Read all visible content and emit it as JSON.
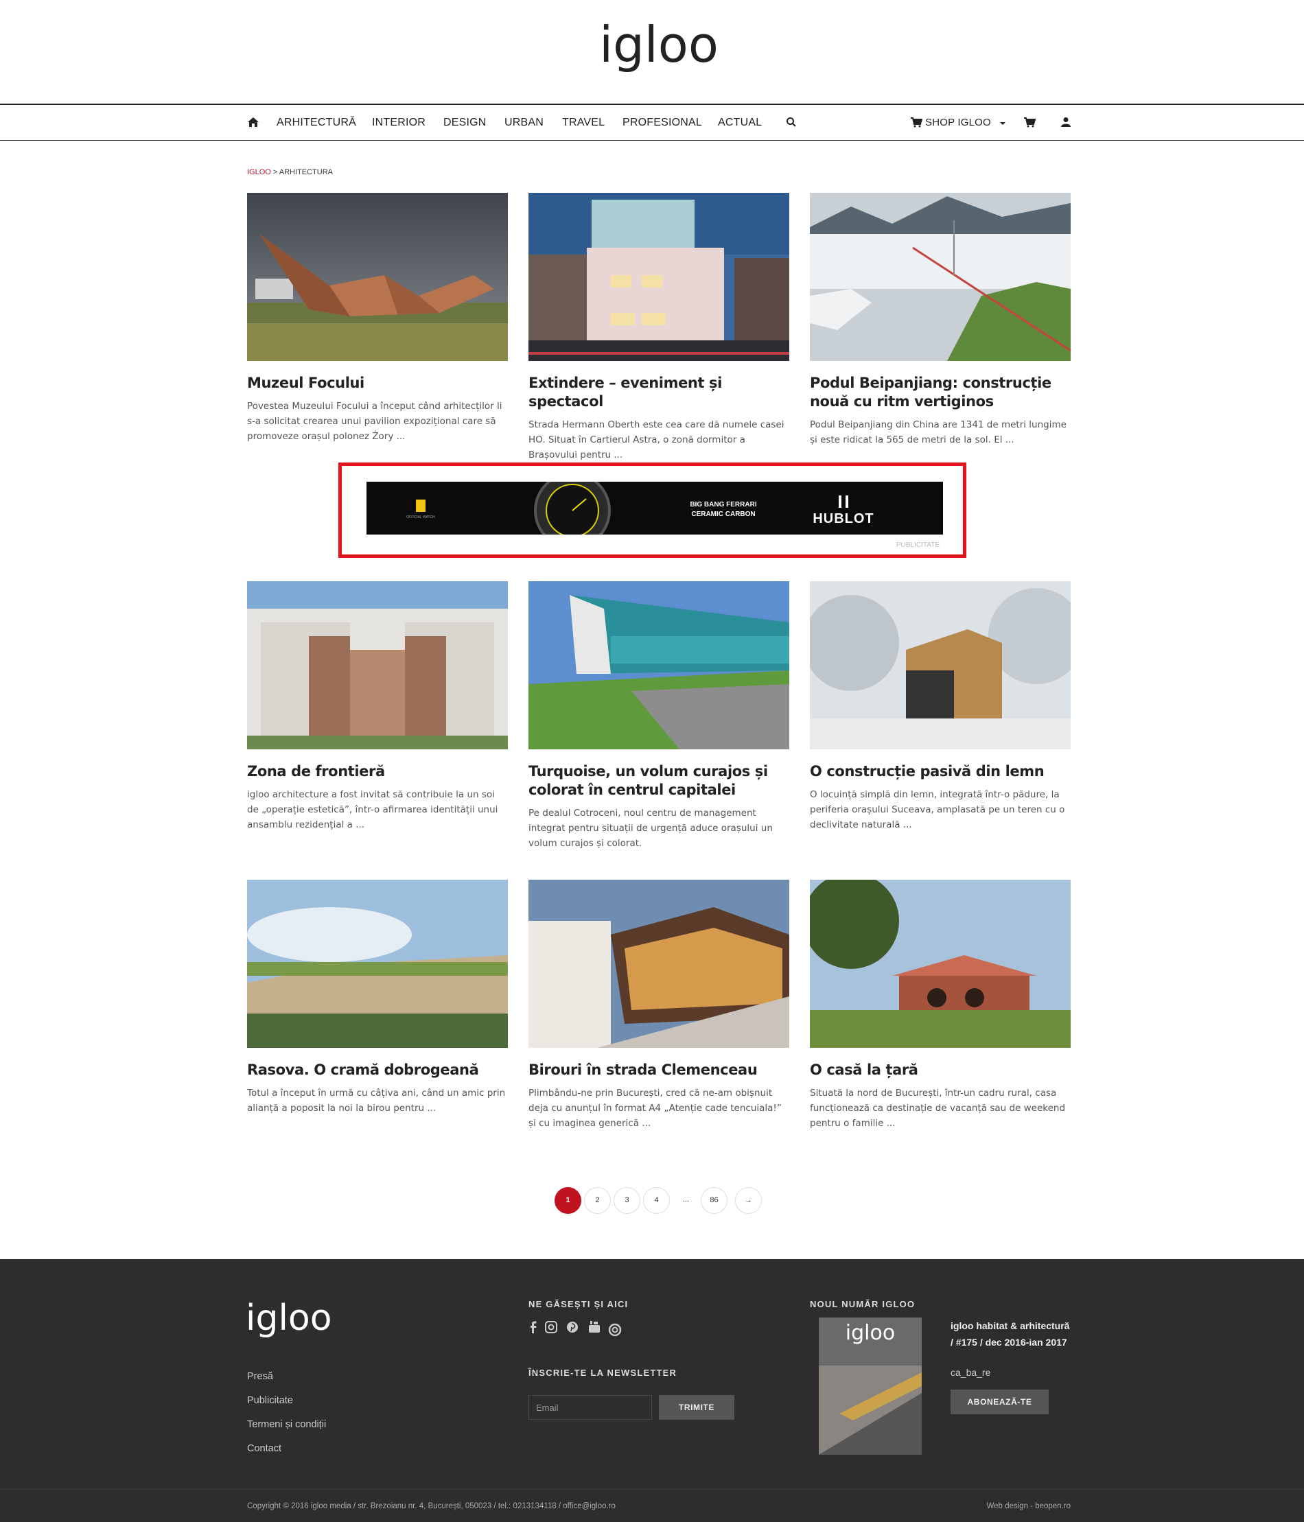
{
  "header": {
    "logo_text": "igloo"
  },
  "nav": {
    "items": [
      {
        "label": "ARHITECTURĂ"
      },
      {
        "label": "INTERIOR"
      },
      {
        "label": "DESIGN"
      },
      {
        "label": "URBAN"
      },
      {
        "label": "TRAVEL"
      },
      {
        "label": "PROFESIONAL"
      },
      {
        "label": "ACTUAL"
      }
    ],
    "shop_label": "SHOP IGLOO",
    "icons": [
      "home-icon",
      "search-icon",
      "cart-icon",
      "user-icon",
      "chevron-down-icon"
    ]
  },
  "breadcrumb": {
    "home": "IGLOO",
    "separator": " > ",
    "current": "ARHITECTURA"
  },
  "articles": [
    {
      "title": "Muzeul Focului",
      "excerpt": "Povestea Muzeului Focului a început când arhitecților li s-a solicitat crearea unui pavilion expozițional care să promoveze orașul polonez Żory ..."
    },
    {
      "title": "Extindere – eveniment și spectacol",
      "excerpt": "Strada Hermann Oberth este cea care dă numele casei HO. Situat în Cartierul Astra, o zonă dormitor a Brașovului pentru ..."
    },
    {
      "title": "Podul Beipanjiang: construcție nouă cu ritm vertiginos",
      "excerpt": "Podul Beipanjiang din China are 1341 de metri lungime și este ridicat la 565 de metri de la sol. El ..."
    },
    {
      "title": "Zona de frontieră",
      "excerpt": "igloo architecture a fost invitat să contribuie la un soi de „operație estetică”, într-o afirmarea identității unui ansamblu rezidențial a ..."
    },
    {
      "title": "Turquoise, un volum curajos și colorat în centrul capitalei",
      "excerpt": "Pe dealul Cotroceni, noul centru de management integrat pentru situații de urgență aduce orașului un volum curajos și colorat."
    },
    {
      "title": "O construcție pasivă din lemn",
      "excerpt": "O locuință simplă din lemn, integrată într-o pădure, la periferia orașului Suceava, amplasată pe un teren cu o declivitate naturală ..."
    },
    {
      "title": "Rasova. O cramă dobrogeană",
      "excerpt": "Totul a început în urmă cu câțiva ani, când un amic prin alianță a poposit la noi la birou pentru ..."
    },
    {
      "title": "Birouri în strada Clemenceau",
      "excerpt": "Plimbându-ne prin București, cred că ne-am obișnuit deja cu anunțul în format A4 „Atenție cade tencuiala!” și cu imaginea generică ..."
    },
    {
      "title": "O casă la țară",
      "excerpt": "Situată la nord de București, într-un cadru rural, casa funcționează ca destinație de vacanță sau de weekend pentru o familie ..."
    }
  ],
  "ad": {
    "label": "PUBLICITATE",
    "headline_1": "BIG BANG FERRARI",
    "headline_2": "CERAMIC CARBON",
    "brand": "HUBLOT",
    "small_text": "OFFICIAL WATCH"
  },
  "pagination": {
    "pages": [
      "1",
      "2",
      "3",
      "4",
      "...",
      "86"
    ],
    "current": "1",
    "next": "→"
  },
  "footer": {
    "logo_text": "igloo",
    "links": [
      "Presă",
      "Publicitate",
      "Termeni și condiții",
      "Contact"
    ],
    "social_heading": "NE GĂSEȘTI ȘI AICI",
    "social_icons": [
      "facebook-icon",
      "instagram-icon",
      "pinterest-icon",
      "youtube-icon",
      "issuu-icon"
    ],
    "newsletter_heading": "ÎNSCRIE-TE LA NEWSLETTER",
    "email_placeholder": "Email",
    "submit_label": "TRIMITE",
    "issue_heading": "NOUL NUMĂR IGLOO",
    "issue_title": "igloo habitat & arhitectură / #175 / dec 2016-ian 2017",
    "issue_subtitle": "ca_ba_re",
    "subscribe_label": "ABONEAZĂ-TE",
    "copyright": "Copyright © 2016 igloo media / str. Brezoianu nr. 4, București, 050023 / tel.: 0213134118 / office@igloo.ro",
    "credits": "Web design - beopen.ro"
  },
  "colors": {
    "accent": "#c1121f",
    "footer_bg": "#2d2d2d",
    "ad_border": "#e3141e"
  }
}
